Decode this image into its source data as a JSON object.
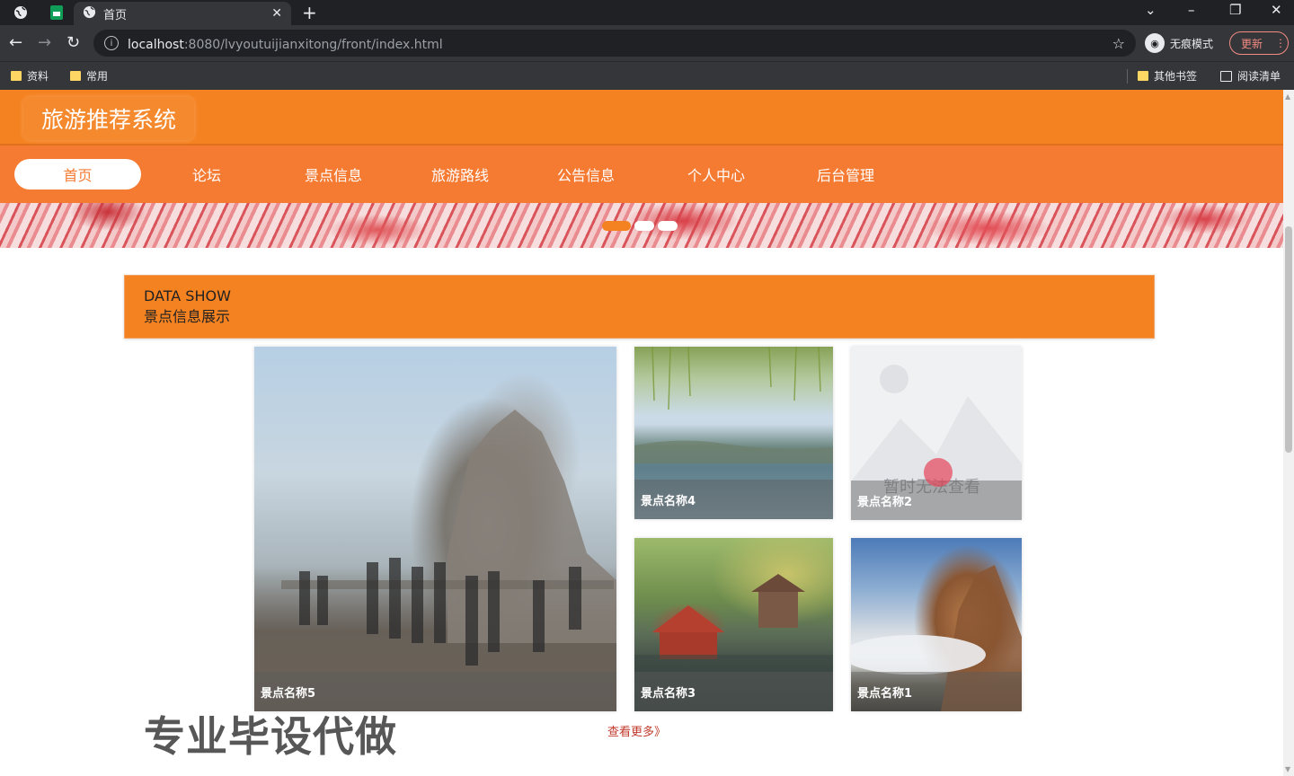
{
  "browser": {
    "tab_title": "首页",
    "url_host": "localhost",
    "url_rest": ":8080/lvyoutuijianxitong/front/index.html",
    "incognito_label": "无痕模式",
    "update_label": "更新",
    "bookmarks": [
      "资料",
      "常用"
    ],
    "bookmarks_right": [
      "其他书签",
      "阅读清单"
    ]
  },
  "site": {
    "title": "旅游推荐系统",
    "nav": [
      "首页",
      "论坛",
      "景点信息",
      "旅游路线",
      "公告信息",
      "个人中心",
      "后台管理"
    ],
    "active_nav": 0,
    "accent": "#f58220",
    "nav_bg": "#f57b33"
  },
  "banner": {
    "slide_count": 3,
    "active_slide": 0
  },
  "section": {
    "title_en": "DATA SHOW",
    "title_cn": "景点信息展示"
  },
  "spots": [
    {
      "name": "景点名称5",
      "image": "mountain-crowd"
    },
    {
      "name": "景点名称4",
      "image": "lake-willow"
    },
    {
      "name": "景点名称2",
      "image": "placeholder",
      "placeholder_text": "暂时无法查看"
    },
    {
      "name": "景点名称3",
      "image": "pagoda-garden"
    },
    {
      "name": "景点名称1",
      "image": "peak-clouds"
    }
  ],
  "more_link": "查看更多》",
  "overlay_watermark": "专业毕设代做"
}
